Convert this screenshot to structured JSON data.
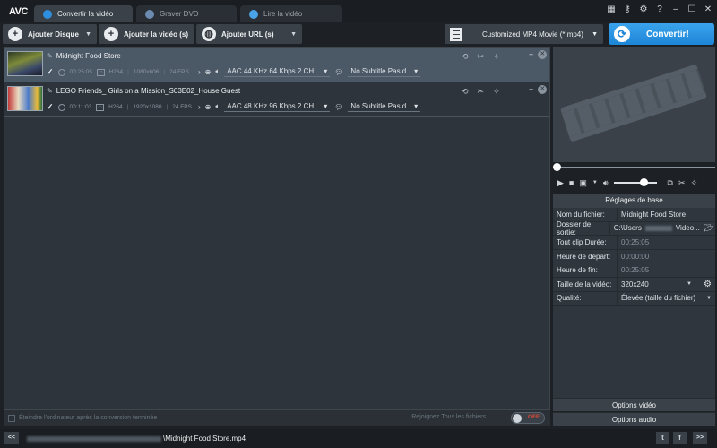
{
  "app": {
    "logo": "AVC"
  },
  "tabs": [
    {
      "label": "Convertir la vidéo",
      "active": true
    },
    {
      "label": "Graver DVD",
      "active": false
    },
    {
      "label": "Lire la vidéo",
      "active": false
    }
  ],
  "window_controls": [
    "calendar-icon",
    "key-icon",
    "gear-icon",
    "help-icon",
    "minimize-icon",
    "maximize-icon",
    "close-icon"
  ],
  "toolbar": {
    "add_disc": "Ajouter Disque",
    "add_video": "Ajouter la vidéo (s)",
    "add_url": "Ajouter URL (s)",
    "profile": "Customized MP4 Movie (*.mp4)",
    "convert": "Convertir!"
  },
  "files": [
    {
      "name": "Midnight Food Store",
      "duration": "00:25:05",
      "codec": "H264",
      "resolution": "1080x606",
      "fps": "24 FPS",
      "audio": "AAC 44 KHz 64 Kbps 2 CH ...",
      "subtitle": "No Subtitle Pas d...",
      "selected": true
    },
    {
      "name": "LEGO Friends_ Girls on a Mission_S03E02_House Guest",
      "duration": "00:11:03",
      "codec": "H264",
      "resolution": "1920x1080",
      "fps": "24 FPS",
      "audio": "AAC 48 KHz 96 Kbps 2 CH ...",
      "subtitle": "No Subtitle Pas d...",
      "selected": false
    }
  ],
  "list_footer": {
    "shutdown_label": "Éteindre l'ordinateur après la conversion terminée",
    "join_label": "Rejoignez Tous les fichiers",
    "toggle_state": "OFF"
  },
  "settings": {
    "header": "Réglages de base",
    "rows": [
      {
        "label": "Nom du fichier:",
        "value": "Midnight Food Store"
      },
      {
        "label": "Dossier de sortie:",
        "value_prefix": "C:\\Users",
        "value_suffix": "Video..."
      },
      {
        "label": "Tout clip Durée:",
        "value": "00:25:05"
      },
      {
        "label": "Heure de départ:",
        "value": "00:00:00"
      },
      {
        "label": "Heure de fin:",
        "value": "00:25:05"
      },
      {
        "label": "Taille de la vidéo:",
        "value": "320x240"
      },
      {
        "label": "Qualité:",
        "value": "Élevée (taille du fichier)"
      }
    ],
    "video_options": "Options vidéo",
    "audio_options": "Options audio"
  },
  "player": {
    "volume": 0.7,
    "seek": 0.0
  },
  "status": {
    "prev": "<<",
    "next": ">>",
    "file_name": "\\Midnight Food Store.mp4"
  }
}
